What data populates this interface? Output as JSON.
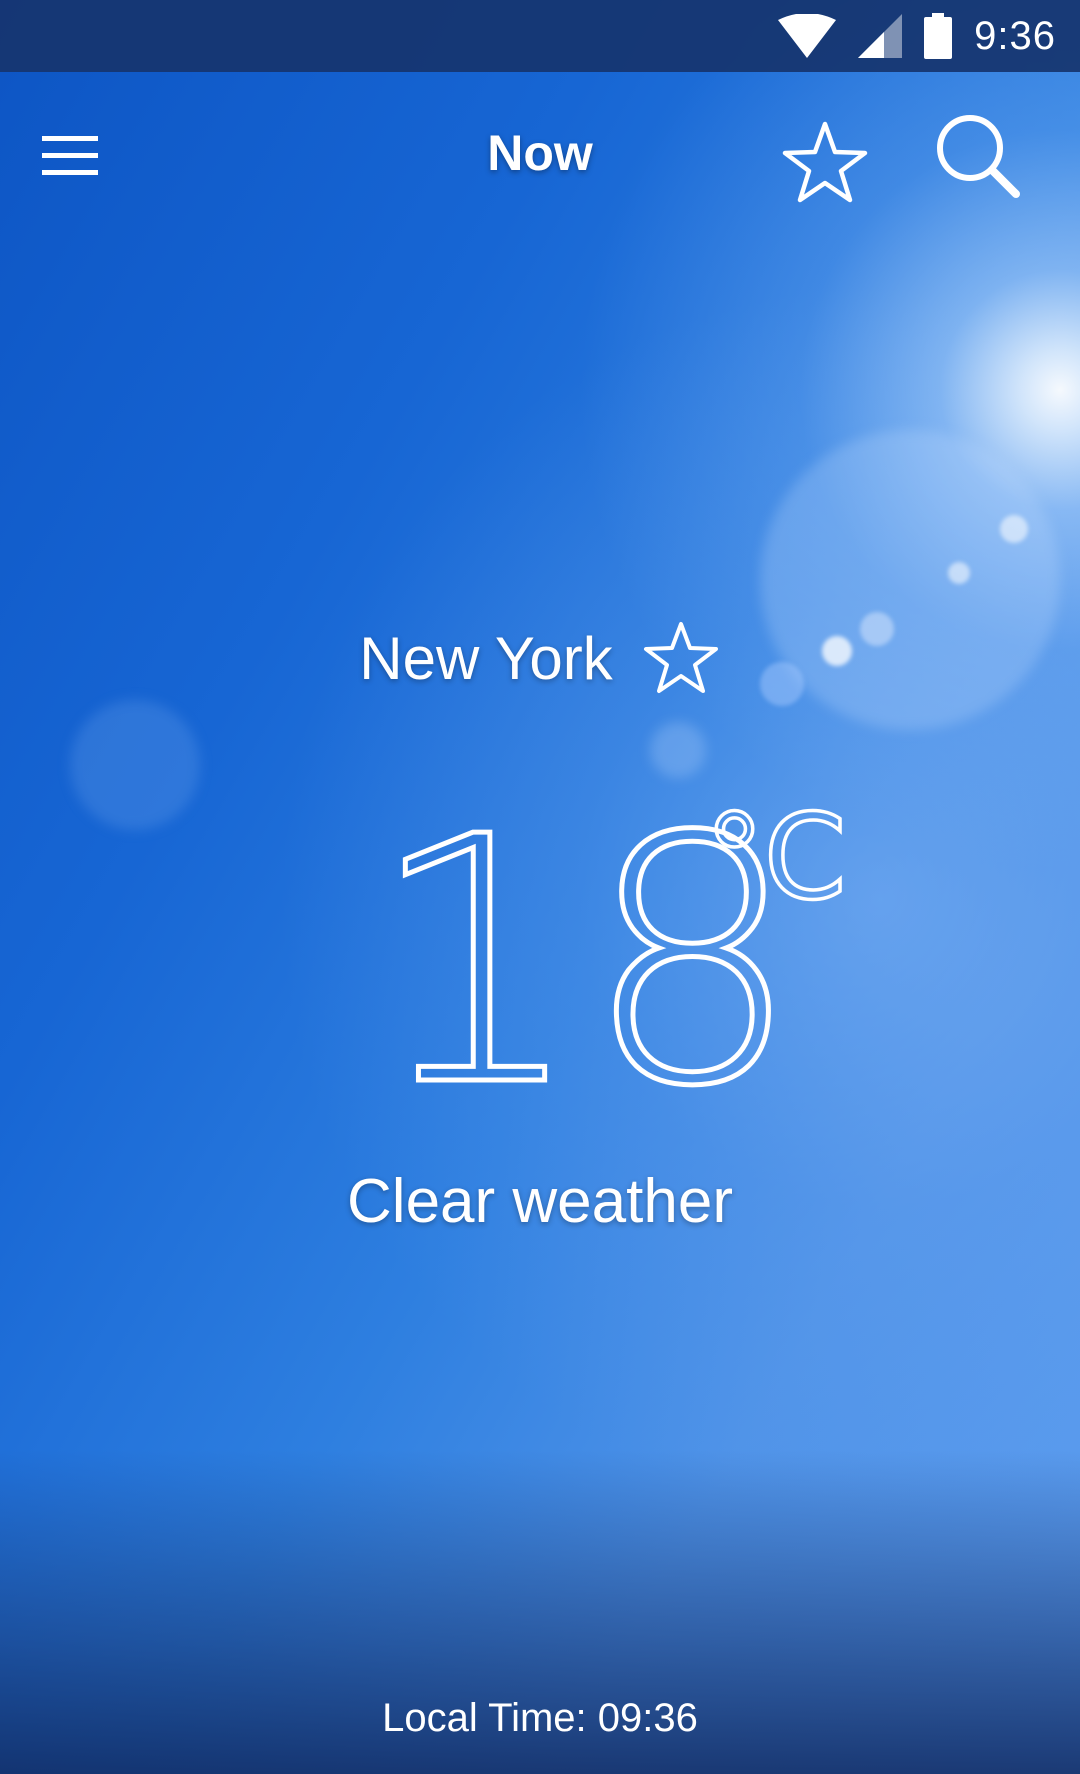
{
  "status_bar": {
    "time": "9:36",
    "icons": [
      "wifi-icon",
      "cell-signal-icon",
      "battery-icon"
    ]
  },
  "toolbar": {
    "title": "Now",
    "menu_icon": "hamburger-menu-icon",
    "favorite_icon": "star-outline-icon",
    "search_icon": "search-icon"
  },
  "weather": {
    "city": "New York",
    "temperature": "18",
    "unit": "°C",
    "condition": "Clear weather"
  },
  "footer": {
    "local_time_label": "Local Time:",
    "local_time_value": "09:36"
  },
  "colors": {
    "status_bar": "#163470",
    "sky_primary": "#1766d4",
    "sky_light": "#5e9ef0",
    "text": "#ffffff"
  }
}
